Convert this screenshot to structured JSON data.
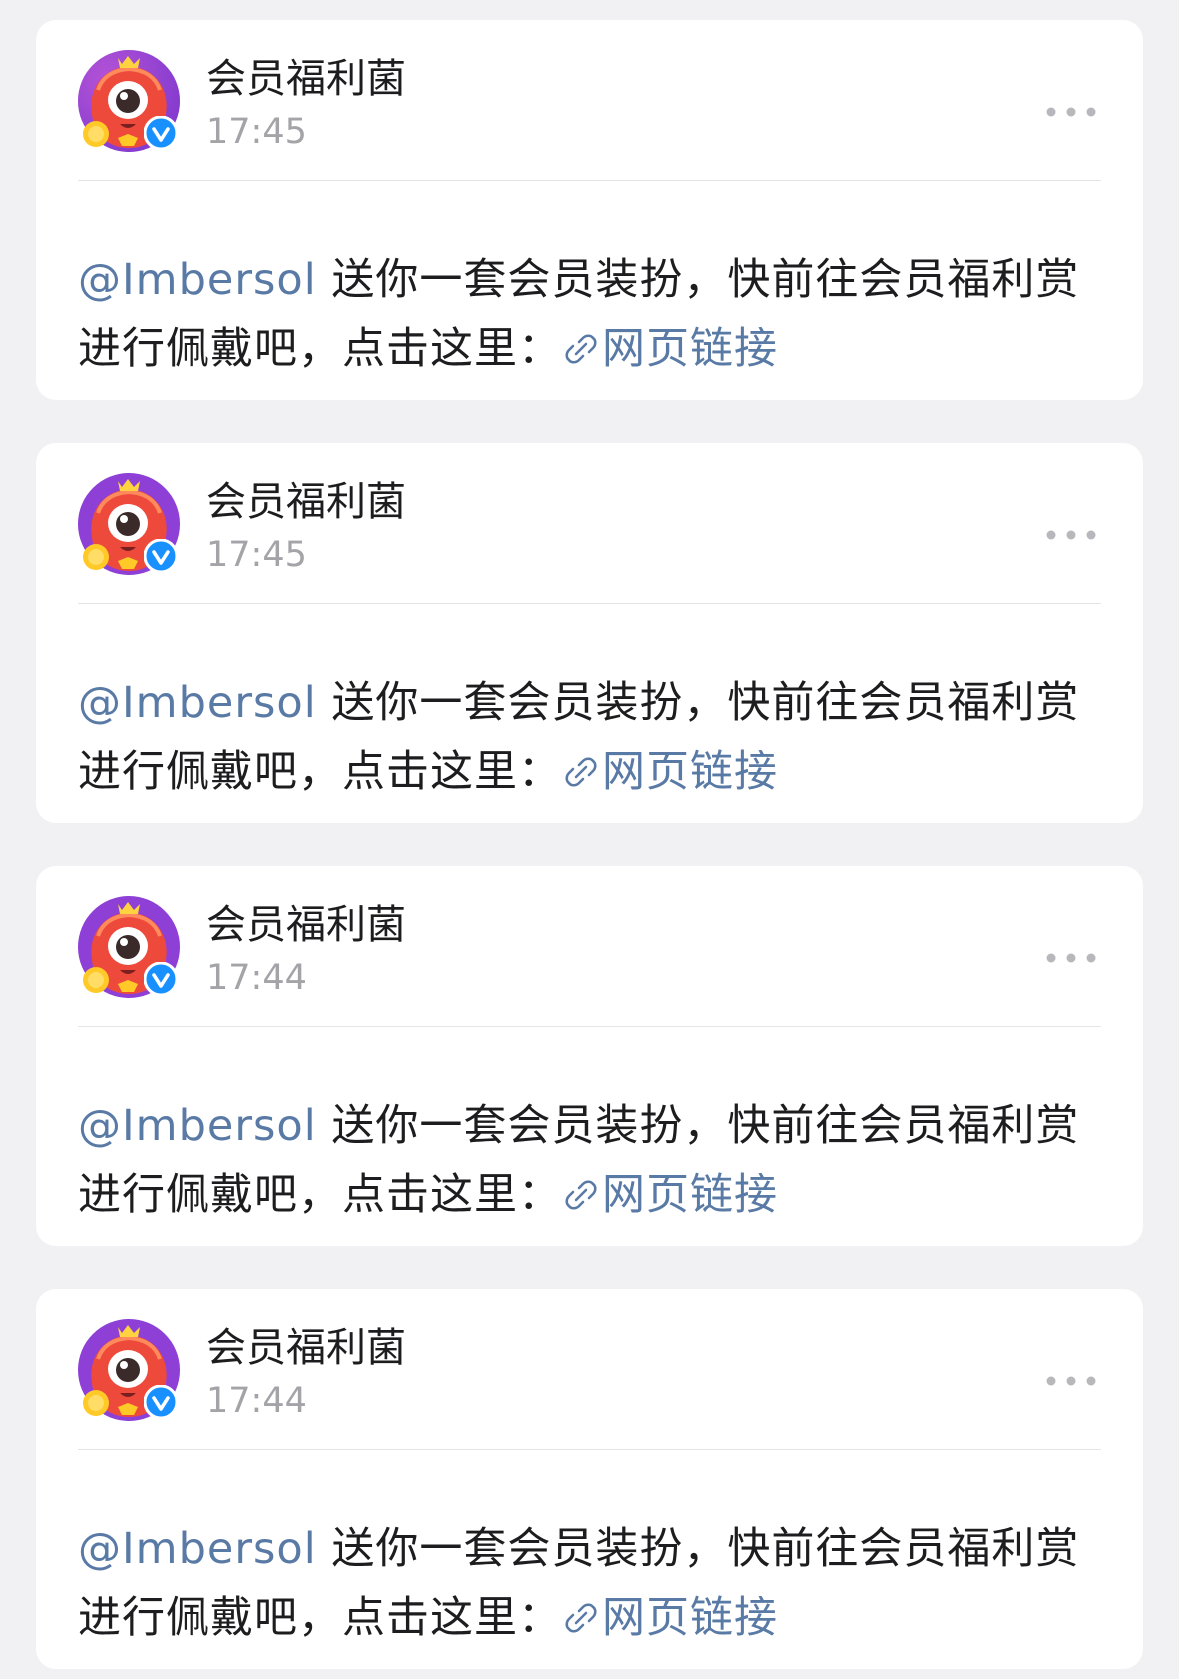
{
  "messages": [
    {
      "sender": "会员福利菌",
      "time": "17:45",
      "mention": "@Imbersol",
      "text_line1": " 送你一套会员装扮，快前往会员福利赏",
      "text_line2": "进行佩戴吧，点击这里：",
      "link_label": "网页链接"
    },
    {
      "sender": "会员福利菌",
      "time": "17:45",
      "mention": "@Imbersol",
      "text_line1": " 送你一套会员装扮，快前往会员福利赏",
      "text_line2": "进行佩戴吧，点击这里：",
      "link_label": "网页链接"
    },
    {
      "sender": "会员福利菌",
      "time": "17:44",
      "mention": "@Imbersol",
      "text_line1": " 送你一套会员装扮，快前往会员福利赏",
      "text_line2": "进行佩戴吧，点击这里：",
      "link_label": "网页链接"
    },
    {
      "sender": "会员福利菌",
      "time": "17:44",
      "mention": "@Imbersol",
      "text_line1": " 送你一套会员装扮，快前往会员福利赏",
      "text_line2": "进行佩戴吧，点击这里：",
      "link_label": "网页链接"
    }
  ],
  "icons": {
    "avatar": "red-mascot-avatar",
    "badge": "verified-badge-icon",
    "more": "more-dots-icon",
    "link": "link-chain-icon"
  },
  "colors": {
    "page_background": "#f1f1f3",
    "card_background": "#ffffff",
    "link_blue": "#5a7aa6",
    "timestamp_gray": "#a3a3a8",
    "verified_blue": "#1890ff",
    "avatar_red": "#e64a3b",
    "avatar_purple": "#8d3fd6"
  }
}
